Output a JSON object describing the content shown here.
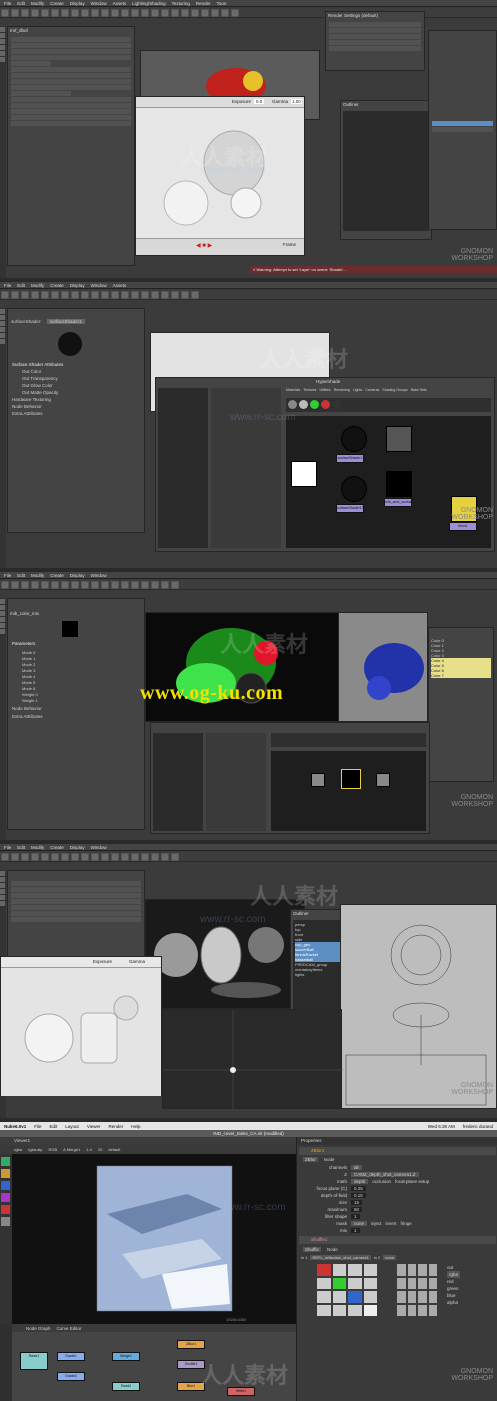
{
  "frame1": {
    "app_title": "mrf_dbuf",
    "menus": [
      "File",
      "Edit",
      "Modify",
      "Create",
      "Display",
      "Window",
      "Assets",
      "Lighting/Shading",
      "Texturing",
      "Render",
      "Toon",
      "Stereo",
      "Paint Effects",
      "Muscle",
      "Pipeline Cache",
      "Help"
    ],
    "render_settings_title": "Render Settings (default)",
    "exposure_label": "Exposure",
    "exposure_value": "0.0",
    "gamma_label": "Gamma",
    "gamma_value": "1.00",
    "frame_label": "Frame",
    "outliner_title": "Outliner",
    "status_text": "// Warning: Attempt to set 'Layer' on scene 'Shader'..."
  },
  "frame2": {
    "hypershade_title": "Hypershade",
    "attr_label": "surfaceShader:",
    "attr_value": "surfaceShader1",
    "sections": [
      "Surface Shader Attributes",
      "Out Color",
      "Out Transparency",
      "Out Glow Color",
      "Out Matte Opacity",
      "Hardware Texturing",
      "Node Behavior",
      "Extra Attributes"
    ],
    "tabs": [
      "Materials",
      "Textures",
      "Utilities",
      "Rendering",
      "Lights",
      "Cameras",
      "Shading Groups",
      "Bake Sets",
      "Projects",
      "Asset Nodes"
    ],
    "nodes": [
      "surfaceShader1",
      "surfaceShader1SG",
      "mib_amb_occlusion1",
      "blinn1"
    ]
  },
  "frame3": {
    "watermark": "www.og-ku.com",
    "attr_title": "mib_color_mix",
    "sections": [
      "Parameters",
      "Node Behavior",
      "Extra Attributes"
    ],
    "mode_rows": [
      "Mode 0",
      "Mode 1",
      "Mode 2",
      "Mode 3",
      "Mode 4",
      "Mode 5",
      "Mode 6",
      "Weight 0",
      "Weight 1"
    ],
    "color_list": [
      "Color 0",
      "Color 1",
      "Color 2",
      "Color 3",
      "Color 4",
      "Color 5",
      "Color 6",
      "Color 7"
    ]
  },
  "frame4": {
    "exposure_label": "Exposure",
    "gamma_label": "Gamma",
    "outliner_title": "Outliner",
    "outliner_items": [
      "persp",
      "top",
      "front",
      "side",
      "cup_geo",
      "soccerBall",
      "tennisRacket",
      "basketball",
      "FREDCAM_group",
      "mentalrayItems",
      "lights"
    ]
  },
  "frame5": {
    "app_name": "Nuke6.0v1",
    "menus": [
      "File",
      "Edit",
      "Layout",
      "Viewer",
      "Render",
      "Help"
    ],
    "window_title": "IND_cover_tanks_CA.nk (modified)",
    "clock": "Wed 6:38 AM",
    "user": "frederic durand",
    "viewer_tab": "Viewer1",
    "viewer_channels": "rgba",
    "viewer_layer": "rgba.alp",
    "viewer_mode": "RGB",
    "viewer_input": "A Merge1",
    "zoom": "1:4",
    "frame": "20",
    "lut": "default",
    "resolution": "1920x1080",
    "bottom_tabs": [
      "Node Graph",
      "Curve Editor"
    ],
    "properties_title": "Properties",
    "zblur_node": "ZBlur1",
    "zblur_tabs": [
      "ZBlur",
      "Node"
    ],
    "channels_label": "channels",
    "channels_value": "all",
    "z_label": "Z",
    "z_value": "CAMZ_depth_shot_camera1.Z",
    "math_label": "math",
    "math_value": "depth",
    "occlusion_label": "occlusion",
    "focal_plane_setup": "focal-plane setup",
    "focus_plane_label": "focus plane (C)",
    "focus_plane_value": "0.25",
    "depth_of_field_label": "depth-of-field",
    "depth_of_field_value": "0.15",
    "size_label": "size",
    "size_value": "15",
    "maximum_label": "maximum",
    "maximum_value": "50",
    "filter_shape_label": "filter shape",
    "filter_shape_value": "1",
    "mix_label": "mix",
    "mix_value": "1",
    "mask_label": "mask",
    "mask_value": "none",
    "inject_label": "inject",
    "invert_label": "invert",
    "fringe_label": "fringe",
    "shuffle_node": "Shuffle1",
    "shuffle_tabs": [
      "Shuffle",
      "Node"
    ],
    "in1_label": "in 1",
    "in1_value": "REFL_reflection_shot_camera1",
    "in2_label": "in 2",
    "in2_value": "none",
    "out_label": "out",
    "out_value": "rgba",
    "out_channels": [
      "red",
      "green",
      "blue",
      "alpha"
    ],
    "graph_nodes": [
      "Read1",
      "Grade1",
      "Merge1",
      "ZBlur1",
      "Shuffle1",
      "Grade2",
      "Blur1",
      "Write1",
      "Read2"
    ]
  },
  "watermarks": {
    "cn": "人人素材",
    "url": "www.rr-sc.com",
    "gnomon_line1": "GNOMON",
    "gnomon_line2": "WORKSHOP"
  },
  "colors": {
    "maya_bg": "#3b3b3b",
    "selection": "#5d8fc4",
    "node_yellow": "#e5d040",
    "node_purple": "#9d8fd6",
    "nuke_accent": "#f0a000",
    "og_watermark": "#f5e100"
  }
}
